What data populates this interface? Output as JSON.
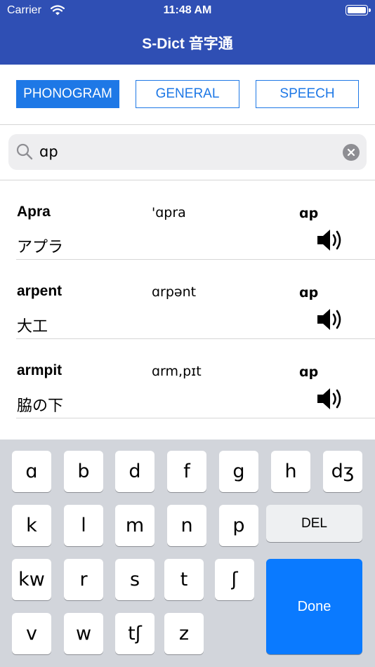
{
  "status": {
    "carrier": "Carrier",
    "time": "11:48 AM"
  },
  "app": {
    "title": "S-Dict 音字通"
  },
  "tabs": [
    "PHONOGRAM",
    "GENERAL",
    "SPEECH"
  ],
  "search": {
    "value": "ɑp"
  },
  "results": [
    {
      "word": "Apra",
      "phonetic": "'ɑpra",
      "tag": "ɑp",
      "meaning": "アプラ"
    },
    {
      "word": "arpent",
      "phonetic": "ɑrpənt",
      "tag": "ɑp",
      "meaning": "大工"
    },
    {
      "word": "armpit",
      "phonetic": "ɑrm,pɪt",
      "tag": "ɑp",
      "meaning": "脇の下"
    }
  ],
  "keyboard": {
    "row1": [
      "ɑ",
      "b",
      "d",
      "f",
      "g",
      "h",
      "dʒ"
    ],
    "row2": [
      "k",
      "l",
      "m",
      "n",
      "p"
    ],
    "row3": [
      "kw",
      "r",
      "s",
      "t",
      "ʃ"
    ],
    "row4": [
      "v",
      "w",
      "tʃ",
      "z"
    ],
    "del": "DEL",
    "done": "Done"
  },
  "colors": {
    "header": "#2f4fb4",
    "accent": "#1e78e6",
    "done": "#0a7aff"
  }
}
